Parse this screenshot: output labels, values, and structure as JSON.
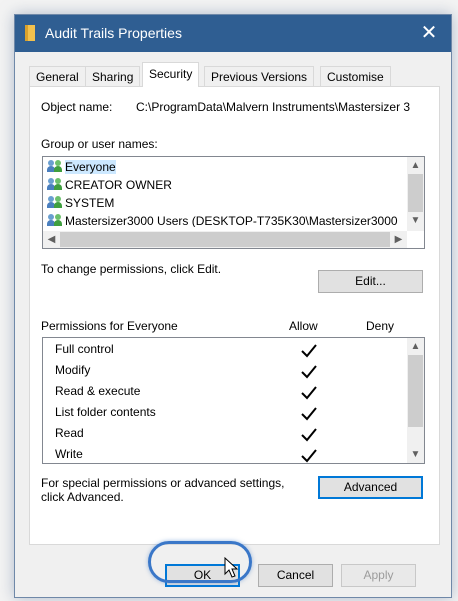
{
  "window": {
    "title": "Audit Trails Properties",
    "close_glyph": "✕"
  },
  "tabs": [
    {
      "label": "General"
    },
    {
      "label": "Sharing"
    },
    {
      "label": "Security"
    },
    {
      "label": "Previous Versions"
    },
    {
      "label": "Customise"
    }
  ],
  "active_tab": "Security",
  "object": {
    "label": "Object name:",
    "value": "C:\\ProgramData\\Malvern Instruments\\Mastersizer 3"
  },
  "groups": {
    "label": "Group or user names:",
    "items": [
      {
        "name": "Everyone",
        "selected": true
      },
      {
        "name": "CREATOR OWNER",
        "selected": false
      },
      {
        "name": "SYSTEM",
        "selected": false
      },
      {
        "name": "Mastersizer3000 Users (DESKTOP-T735K30\\Mastersizer3000",
        "selected": false
      }
    ]
  },
  "change_hint": "To change permissions, click Edit.",
  "edit_button": "Edit...",
  "permissions": {
    "header": "Permissions for Everyone",
    "allow_label": "Allow",
    "deny_label": "Deny",
    "rows": [
      {
        "name": "Full control",
        "allow": true,
        "deny": false
      },
      {
        "name": "Modify",
        "allow": true,
        "deny": false
      },
      {
        "name": "Read & execute",
        "allow": true,
        "deny": false
      },
      {
        "name": "List folder contents",
        "allow": true,
        "deny": false
      },
      {
        "name": "Read",
        "allow": true,
        "deny": false
      },
      {
        "name": "Write",
        "allow": true,
        "deny": false
      }
    ]
  },
  "special_hint_line1": "For special permissions or advanced settings,",
  "special_hint_line2": "click Advanced.",
  "advanced_button": "Advanced",
  "footer": {
    "ok": "OK",
    "cancel": "Cancel",
    "apply": "Apply"
  },
  "colors": {
    "titlebar": "#2f5e92",
    "focus": "#0078d7",
    "selection": "#cce8ff",
    "annotation": "#3a77c8"
  },
  "icons": {
    "title": "folder-icon",
    "user": "user-group-icon",
    "check": "checkmark-icon",
    "cursor": "mouse-pointer-icon"
  }
}
